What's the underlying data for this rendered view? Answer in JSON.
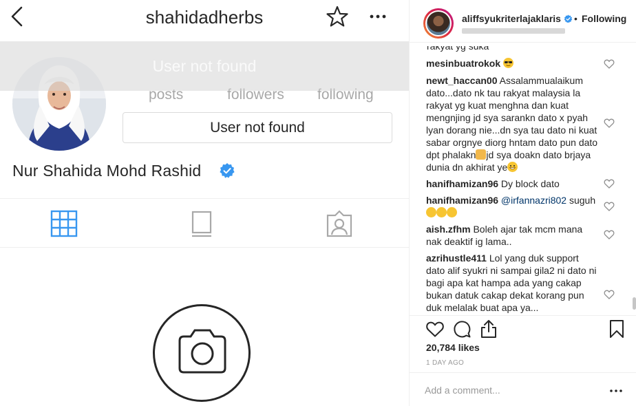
{
  "profile": {
    "username": "shahidadherbs",
    "full_name": "Nur Shahida Mohd Rashid",
    "stats": {
      "posts_label": "posts",
      "followers_label": "followers",
      "following_label": "following"
    },
    "overlay_text": "User not found",
    "notfound_button_label": "User not found",
    "icons": [
      "back-icon",
      "star-icon",
      "more-icon",
      "verified-icon",
      "grid-icon",
      "igtv-icon",
      "tagged-icon",
      "camera-icon"
    ]
  },
  "post": {
    "username": "aliffsyukriterlajaklaris",
    "dot": "•",
    "follow_status": "Following",
    "comments": [
      {
        "user": "mesinbuatrokok",
        "text": ""
      },
      {
        "user": "newt_haccan00",
        "text": "Assalammualaikum dato...dato nk tau rakyat malaysia la rakyat yg kuat menghna dan kuat mengnjing jd sya sarankn dato x pyah lyan dorang nie...dn sya tau dato ni kuat sabar orgnye diorg hntam dato pun dato dpt phalakn",
        "text2": "jd sya doakn dato brjaya dunia dn akhirat ye"
      },
      {
        "user": "hanifhamizan96",
        "text": "Dy block dato"
      },
      {
        "user": "hanifhamizan96",
        "mention": "@irfannazri802",
        "text": "suguh"
      },
      {
        "user": "aish.zfhm",
        "text": "Boleh ajar tak mcm mana nak deaktif ig lama.."
      },
      {
        "user": "azrihustle411",
        "text": "Lol yang duk support dato alif syukri ni sampai gila2 ni dato ni bagi apa kat hampa ada yang cakap bukan datuk cakap dekat korang pun duk melalak buat apa ya..."
      }
    ],
    "likes": "20,784 likes",
    "time": "1 DAY AGO",
    "comment_placeholder": "Add a comment..."
  },
  "colors": {
    "verified": "#3897f0",
    "text": "#262626",
    "muted": "#999999",
    "mention": "#003569",
    "active_tab": "#3897f0"
  }
}
